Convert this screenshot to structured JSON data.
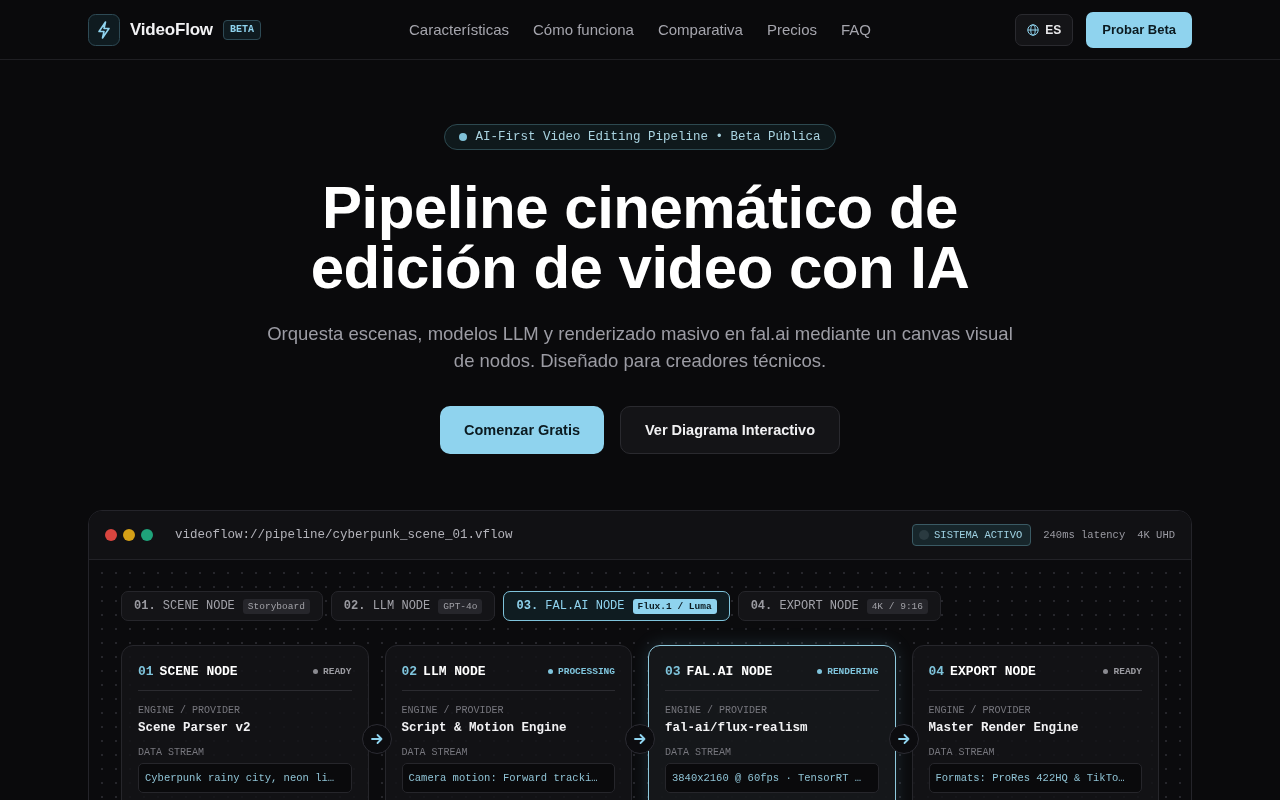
{
  "header": {
    "brand": "VideoFlow",
    "badge": "BETA",
    "nav": [
      "Características",
      "Cómo funciona",
      "Comparativa",
      "Precios",
      "FAQ"
    ],
    "language": "ES",
    "cta": "Probar Beta"
  },
  "hero": {
    "announcement": "AI-First Video Editing Pipeline • Beta Pública",
    "title": "Pipeline cinemático de edición de video con IA",
    "subtitle": "Orquesta escenas, modelos LLM y renderizado masivo en fal.ai mediante un canvas visual de nodos. Diseñado para creadores técnicos.",
    "buttons": [
      {
        "label": "Comenzar Gratis",
        "kind": "primary"
      },
      {
        "label": "Ver Diagrama Interactivo",
        "kind": "secondary"
      }
    ]
  },
  "pipeline_window": {
    "path": "videoflow://pipeline/cyberpunk_scene_01.vflow",
    "status": "SISTEMA ACTIVO",
    "latency": "240ms latency",
    "resolution": "4K UHD",
    "tabs": [
      {
        "number": "01.",
        "label": "SCENE NODE",
        "tag": "Storyboard",
        "selected": false
      },
      {
        "number": "02.",
        "label": "LLM NODE",
        "tag": "GPT-4o",
        "selected": false
      },
      {
        "number": "03.",
        "label": "FAL.AI NODE",
        "tag": "Flux.1 / Luma",
        "selected": true
      },
      {
        "number": "04.",
        "label": "EXPORT NODE",
        "tag": "4K / 9:16",
        "selected": false
      }
    ],
    "nodes": [
      {
        "number": "01",
        "title": "SCENE NODE",
        "status": "READY",
        "status_active": false,
        "selected": false,
        "engine_label": "ENGINE / PROVIDER",
        "engine": "Scene Parser v2",
        "stream_label": "DATA STREAM",
        "stream": "Cyberpunk rainy city, neon li…"
      },
      {
        "number": "02",
        "title": "LLM NODE",
        "status": "PROCESSING",
        "status_active": true,
        "selected": false,
        "engine_label": "ENGINE / PROVIDER",
        "engine": "Script & Motion Engine",
        "stream_label": "DATA STREAM",
        "stream": "Camera motion: Forward tracki…"
      },
      {
        "number": "03",
        "title": "FAL.AI NODE",
        "status": "RENDERING",
        "status_active": true,
        "selected": true,
        "engine_label": "ENGINE / PROVIDER",
        "engine": "fal-ai/flux-realism",
        "stream_label": "DATA STREAM",
        "stream": "3840x2160 @ 60fps · TensorRT …"
      },
      {
        "number": "04",
        "title": "EXPORT NODE",
        "status": "READY",
        "status_active": false,
        "selected": false,
        "engine_label": "ENGINE / PROVIDER",
        "engine": "Master Render Engine",
        "stream_label": "DATA STREAM",
        "stream": "Formats: ProRes 422HQ & TikTo…"
      }
    ]
  }
}
